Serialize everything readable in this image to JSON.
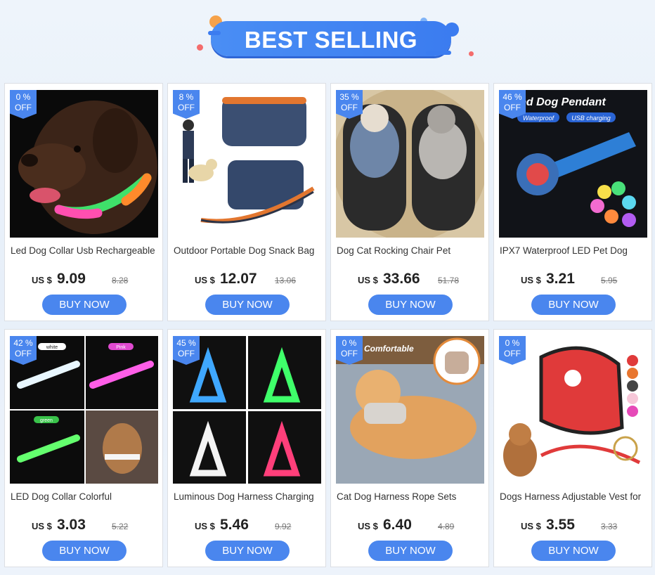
{
  "banner": {
    "title": "BEST SELLING"
  },
  "colors": {
    "accent": "#4a86ee",
    "banner": "#3b7cf0",
    "price": "#222222"
  },
  "products": [
    {
      "discount_num": "0 %",
      "discount_label": "OFF",
      "title": "Led Dog Collar Usb Rechargeable",
      "currency": "US $",
      "price": "9.09",
      "old_price": "8.28",
      "buy_label": "BUY NOW",
      "image": "dog-led-collar"
    },
    {
      "discount_num": "8 %",
      "discount_label": "OFF",
      "title": "Outdoor Portable Dog Snack Bag",
      "currency": "US $",
      "price": "12.07",
      "old_price": "13.06",
      "buy_label": "BUY NOW",
      "image": "dog-snack-bag"
    },
    {
      "discount_num": "35 %",
      "discount_label": "OFF",
      "title": "Dog Cat Rocking Chair Pet",
      "currency": "US $",
      "price": "33.66",
      "old_price": "51.78",
      "buy_label": "BUY NOW",
      "image": "pet-rocking-chair"
    },
    {
      "discount_num": "46 %",
      "discount_label": "OFF",
      "title": "IPX7 Waterproof LED Pet Dog",
      "currency": "US $",
      "price": "3.21",
      "old_price": "5.95",
      "buy_label": "BUY NOW",
      "image": "led-pendant",
      "image_text": {
        "heading": "ed Dog Pendant",
        "tag1": "Waterproof",
        "tag2": "USB charging"
      }
    },
    {
      "discount_num": "42 %",
      "discount_label": "OFF",
      "title": "LED Dog Collar Colorful",
      "currency": "US $",
      "price": "3.03",
      "old_price": "5.22",
      "buy_label": "BUY NOW",
      "image": "colorful-collars",
      "image_text": {
        "c1": "white",
        "c2": "Pink",
        "c3": "green"
      }
    },
    {
      "discount_num": "45 %",
      "discount_label": "OFF",
      "title": "Luminous Dog Harness Charging",
      "currency": "US $",
      "price": "5.46",
      "old_price": "9.92",
      "buy_label": "BUY NOW",
      "image": "luminous-harness"
    },
    {
      "discount_num": "0 %",
      "discount_label": "OFF",
      "title": "Cat Dog Harness Rope Sets",
      "currency": "US $",
      "price": "6.40",
      "old_price": "4.89",
      "buy_label": "BUY NOW",
      "image": "cat-harness",
      "image_text": {
        "heading": "Comfortable"
      }
    },
    {
      "discount_num": "0 %",
      "discount_label": "OFF",
      "title": "Dogs Harness Adjustable Vest for",
      "currency": "US $",
      "price": "3.55",
      "old_price": "3.33",
      "buy_label": "BUY NOW",
      "image": "dog-harness-vest"
    }
  ]
}
